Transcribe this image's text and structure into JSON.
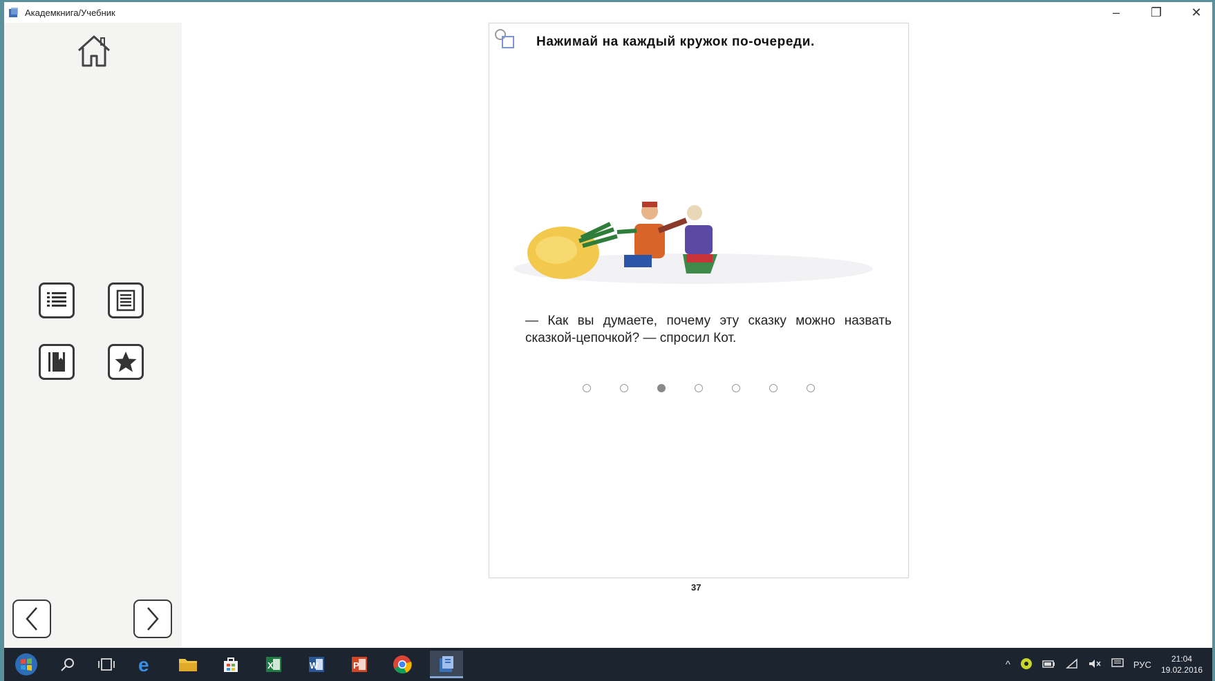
{
  "window": {
    "title": "Академкнига/Учебник",
    "minimize_symbol": "–",
    "restore_symbol": "❐",
    "close_symbol": "✕"
  },
  "sidebar": {
    "home_icon": "home-icon",
    "buttons": [
      {
        "name": "table-of-contents",
        "icon": "list-icon"
      },
      {
        "name": "page-view",
        "icon": "document-icon"
      },
      {
        "name": "bookmarks",
        "icon": "book-icon"
      },
      {
        "name": "favorites",
        "icon": "star-icon"
      }
    ],
    "prev_icon": "chevron-left-icon",
    "next_icon": "chevron-right-icon"
  },
  "page": {
    "instruction": "Нажимай на каждый кружок по-очереди.",
    "story_text": "— Как вы думаете, почему эту сказку можно назвать сказкой-цепочкой? — спросил Кот.",
    "pagination_total": 7,
    "pagination_active_index": 2,
    "page_number": "37"
  },
  "taskbar": {
    "apps": [
      "start-button",
      "search",
      "task-view",
      "edge",
      "file-explorer",
      "store",
      "excel",
      "word",
      "powerpoint",
      "chrome",
      "akademkniga"
    ],
    "language": "РУС",
    "time": "21:04",
    "date": "19.02.2016"
  },
  "colors": {
    "frame": "#5a8f9c",
    "sidebar_bg": "#f4f5f3",
    "taskbar_bg": "#1c2430"
  }
}
